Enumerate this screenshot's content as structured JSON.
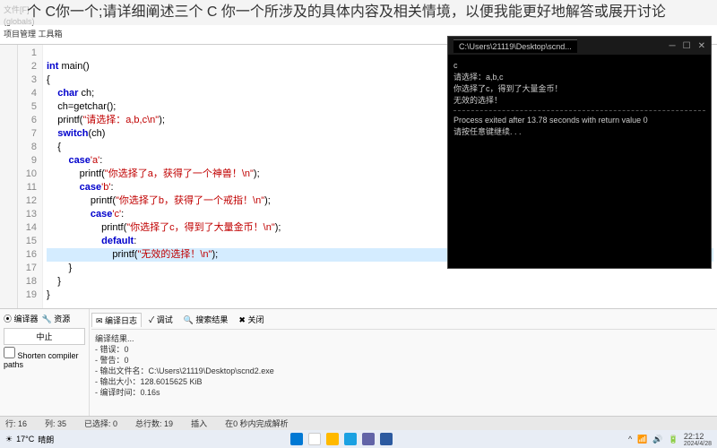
{
  "overlay": "个 C你一个;请详细阐述三个 C 你一个所涉及的具体内容及相关情境，以便我能更好地解答或展开讨论",
  "ide_header": {
    "file_label": "文件[F]",
    "project_label": "项目管理 工具箱",
    "scope": "(globals)"
  },
  "gutter_lines": [
    "1",
    "2",
    "3",
    "4",
    "5",
    "6",
    "7",
    "8",
    "9",
    "10",
    "11",
    "12",
    "13",
    "14",
    "15",
    "16",
    "17",
    "18",
    "19"
  ],
  "code": {
    "l1": "",
    "l2_a": "int",
    "l2_b": " main()",
    "l3": "{",
    "l4_a": "    char",
    "l4_b": " ch;",
    "l5": "    ch=getchar();",
    "l6_a": "    printf(",
    "l6_s": "\"请选择：a,b,c\\n\"",
    "l6_b": ");",
    "l7_a": "    switch",
    "l7_b": "(ch)",
    "l8": "    {",
    "l9_a": "        case",
    "l9_s": "'a'",
    "l9_b": ":",
    "l10_a": "            printf(",
    "l10_s": "\"你选择了a，获得了一个神兽！\\n\"",
    "l10_b": ");",
    "l11_a": "            case",
    "l11_s": "'b'",
    "l11_b": ":",
    "l12_a": "                printf(",
    "l12_s": "\"你选择了b，获得了一个戒指！\\n\"",
    "l12_b": ");",
    "l13_a": "                case",
    "l13_s": "'c'",
    "l13_b": ":",
    "l14_a": "                    printf(",
    "l14_s": "\"你选择了c，得到了大量金币！\\n\"",
    "l14_b": ");",
    "l15_a": "                    default",
    "l15_b": ":",
    "l16_a": "                        printf(",
    "l16_s": "\"无效的选择！\\n\"",
    "l16_b": ");",
    "l17": "        }",
    "l18": "    }",
    "l19": "}"
  },
  "terminal": {
    "title": "C:\\Users\\21119\\Desktop\\scnd...",
    "close": "✕",
    "lines": [
      "c",
      "请选择：a,b,c",
      "你选择了c，得到了大量金币！",
      "无效的选择！",
      "",
      "",
      "Process exited after 13.78 seconds with return value 0",
      "请按任意键继续. . ."
    ]
  },
  "bottom": {
    "tabs_left": [
      "⦿ 编译器",
      "🔧 资源"
    ],
    "btn_stop": "中止",
    "chk": "Shorten compiler paths",
    "tabs_right": {
      "log": "✉ 编译日志",
      "debug": "✓ 调试",
      "search": "🔍 搜索结果",
      "close": "✖ 关闭"
    },
    "output_title": "编译结果...",
    "output_lines": [
      "- 错误：0",
      "- 警告：0",
      "- 输出文件名：C:\\Users\\21119\\Desktop\\scnd2.exe",
      "- 输出大小：128.6015625 KiB",
      "- 编译时间：0.16s"
    ]
  },
  "status": {
    "line": "行: 16",
    "col": "列: 35",
    "sel": "已选择: 0",
    "total": "总行数: 19",
    "ins": "插入",
    "done": "在0 秒内完成解析"
  },
  "taskbar": {
    "temp": "17°C",
    "cond": "晴朗",
    "time": "22:12",
    "date": "2024/4/28"
  }
}
